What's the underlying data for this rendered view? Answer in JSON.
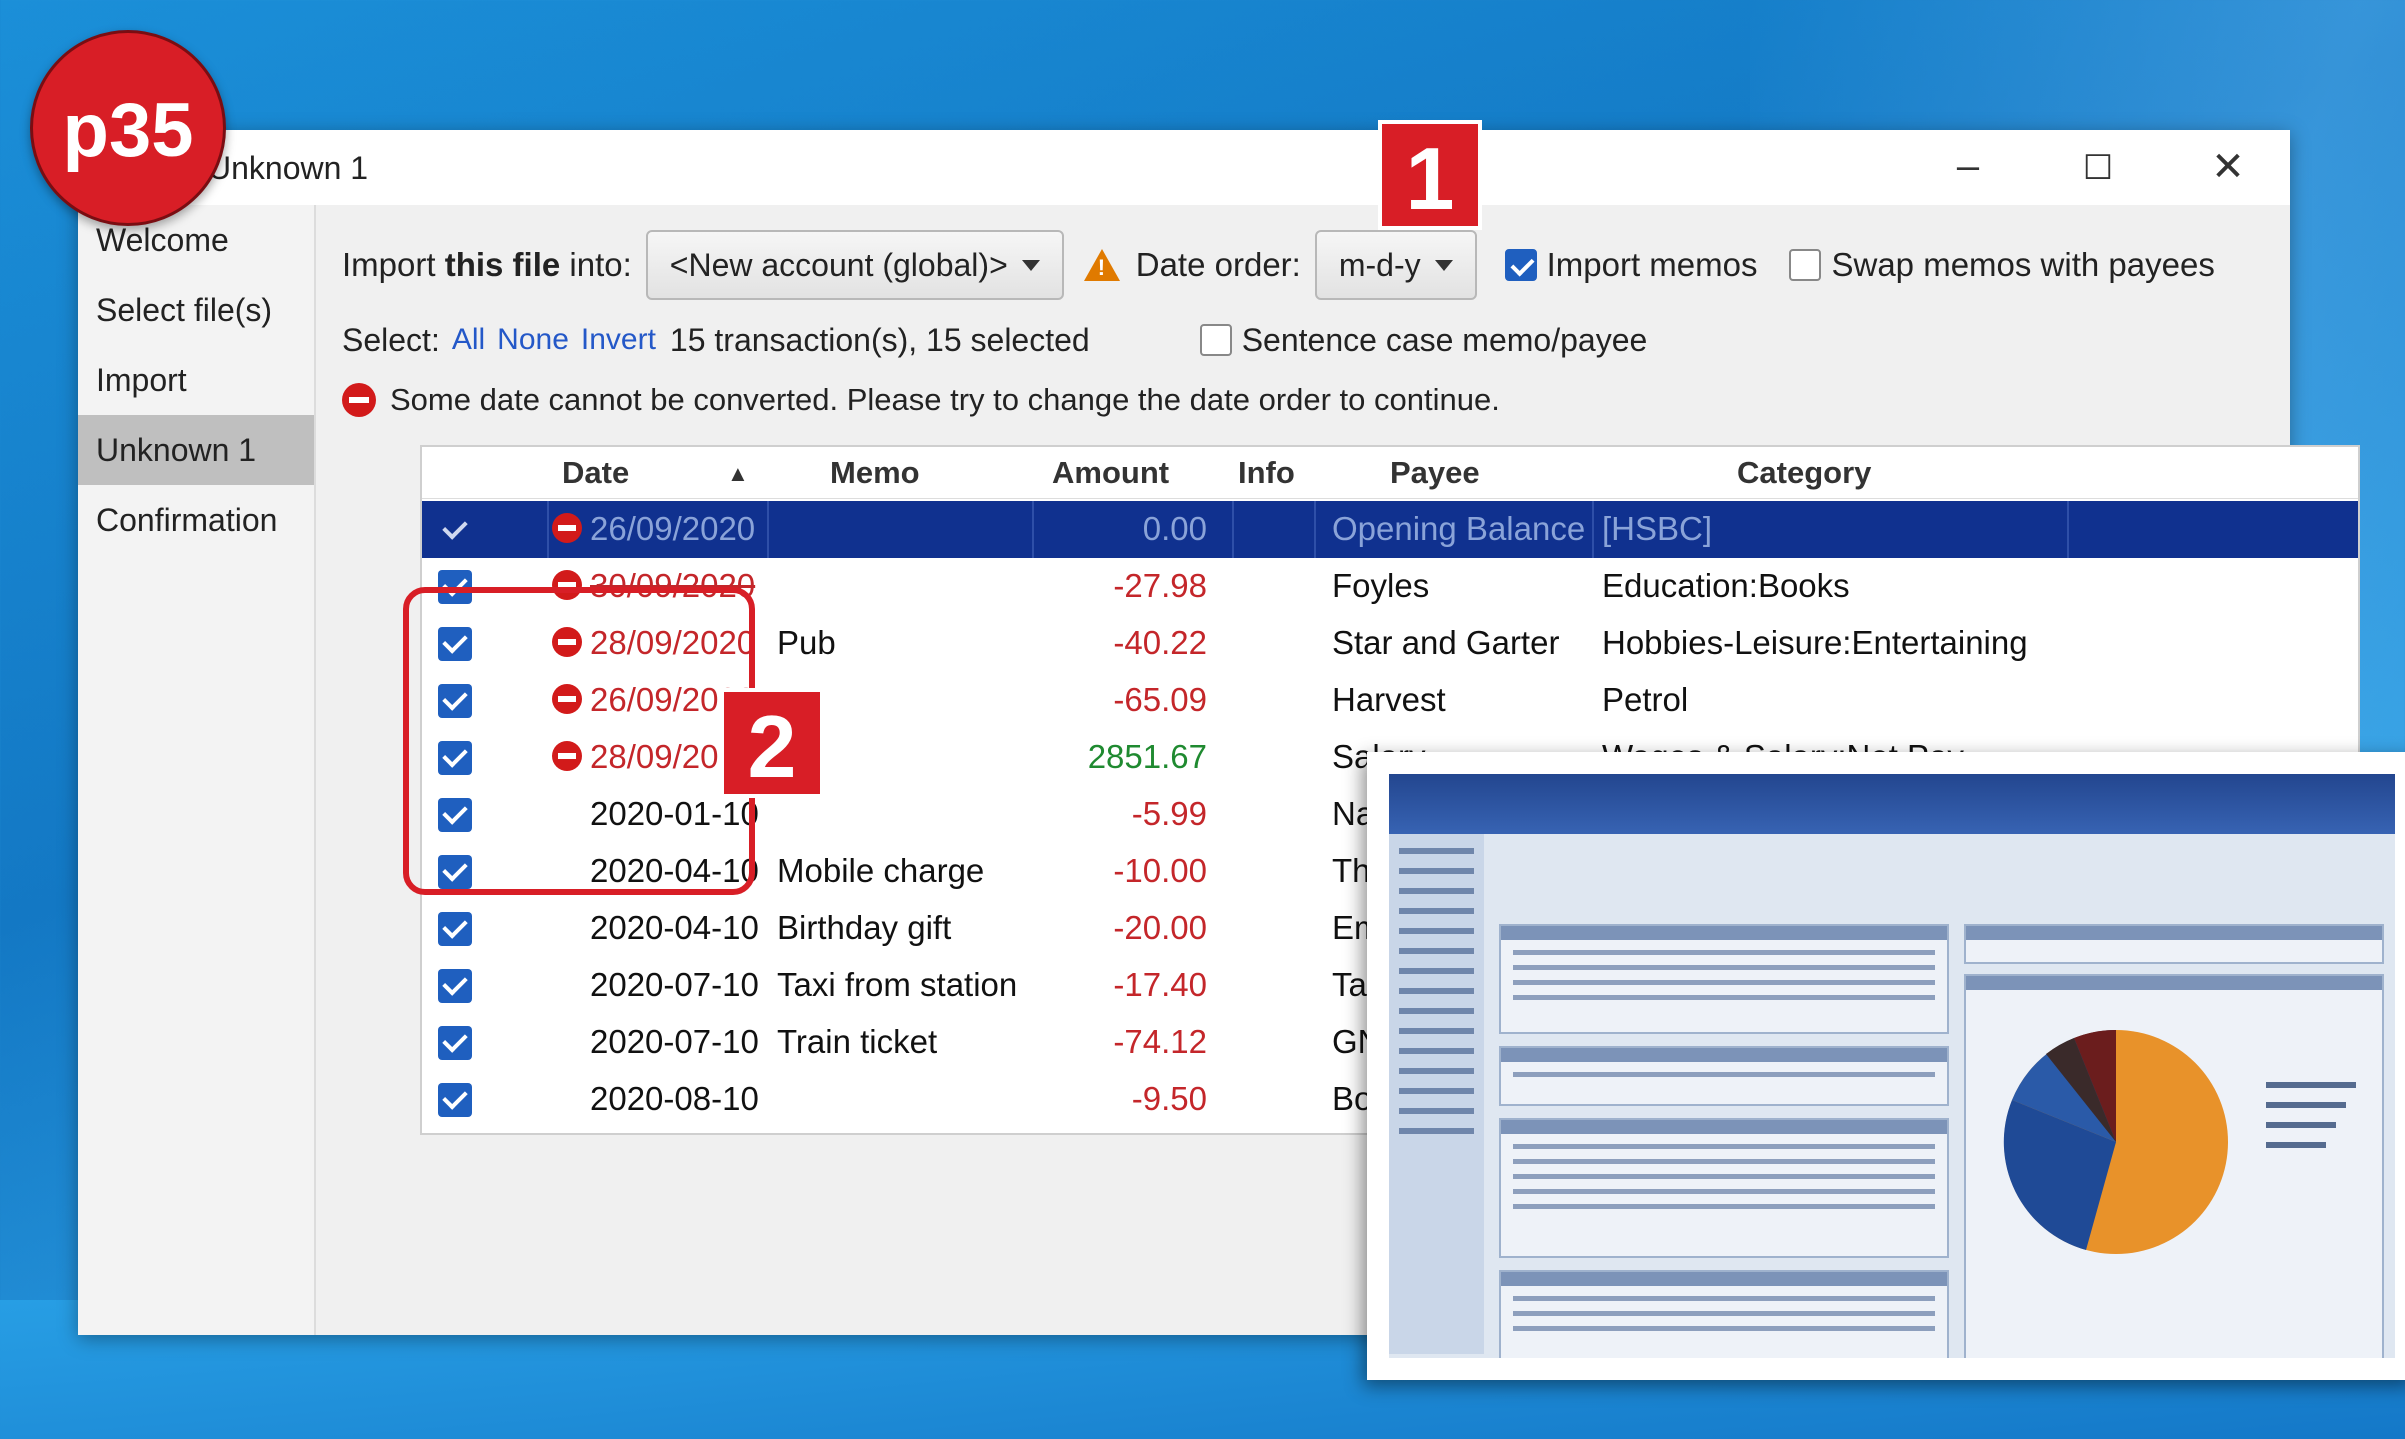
{
  "badge": "p35",
  "window": {
    "title": "Unknown 1",
    "controls": [
      "‒",
      "☐",
      "✕"
    ]
  },
  "nav": {
    "items": [
      "Welcome",
      "Select file(s)",
      "Import",
      "Unknown 1",
      "Confirmation"
    ]
  },
  "toolbar": {
    "import_prefix": "Import",
    "import_bold": "this file",
    "import_suffix": "into:",
    "account_value": "<New account (global)>",
    "date_order_label": "Date order:",
    "date_order_value": "m-d-y",
    "import_memos_label": "Import memos",
    "import_memos_checked": true,
    "swap_memos_label": "Swap memos with payees",
    "swap_memos_checked": false
  },
  "selection": {
    "label": "Select:",
    "all": "All",
    "none": "None",
    "invert": "Invert",
    "summary": "15 transaction(s), 15 selected",
    "sentence_case_label": "Sentence case memo/payee",
    "sentence_case_checked": false
  },
  "error_message": "Some date cannot be converted. Please try to change the date order to continue.",
  "table": {
    "columns": [
      "Date",
      "Memo",
      "Amount",
      "Info",
      "Payee",
      "Category"
    ],
    "rows": [
      {
        "date": "26/09/2020",
        "memo": "",
        "amount": "0.00",
        "payee": "Opening Balance",
        "category": "[HSBC]",
        "error": true,
        "selected": true
      },
      {
        "date": "30/09/2020",
        "memo": "",
        "amount": "-27.98",
        "payee": "Foyles",
        "category": "Education:Books",
        "error": true
      },
      {
        "date": "28/09/2020",
        "memo": "Pub",
        "amount": "-40.22",
        "payee": "Star and Garter",
        "category": "Hobbies-Leisure:Entertaining",
        "error": true
      },
      {
        "date": "26/09/2020",
        "memo": "",
        "amount": "-65.09",
        "payee": "Harvest",
        "category": "Petrol",
        "error": true
      },
      {
        "date": "28/09/2020",
        "memo": "",
        "amount": "2851.67",
        "payee": "Salary",
        "category": "Wages & Salary:Net Pay",
        "error": true
      },
      {
        "date": "2020-01-10",
        "memo": "",
        "amount": "-5.99",
        "payee": "National",
        "category": ""
      },
      {
        "date": "2020-04-10",
        "memo": "Mobile charge",
        "amount": "-10.00",
        "payee": "Three",
        "category": ""
      },
      {
        "date": "2020-04-10",
        "memo": "Birthday gift",
        "amount": "-20.00",
        "payee": "Emily",
        "category": ""
      },
      {
        "date": "2020-07-10",
        "memo": "Taxi from station",
        "amount": "-17.40",
        "payee": "Taxi",
        "category": ""
      },
      {
        "date": "2020-07-10",
        "memo": "Train ticket",
        "amount": "-74.12",
        "payee": "GNER",
        "category": ""
      },
      {
        "date": "2020-08-10",
        "memo": "",
        "amount": "-9.50",
        "payee": "Boots",
        "category": ""
      }
    ]
  },
  "markers": [
    "1",
    "2"
  ],
  "colors": {
    "accent_red": "#d81e26",
    "selected_row": "#10318f",
    "negative": "#c4262a",
    "positive": "#1f8a30"
  }
}
